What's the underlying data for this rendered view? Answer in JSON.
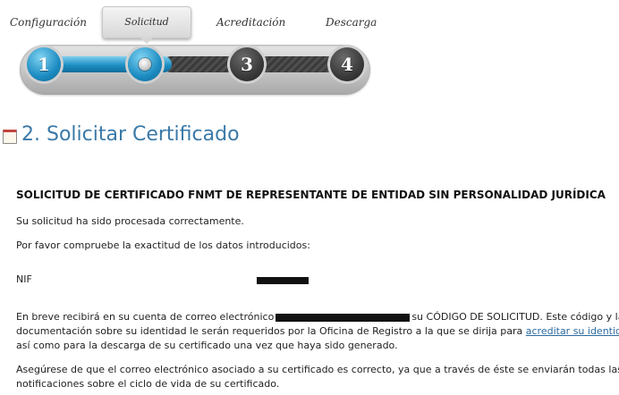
{
  "stepper": {
    "steps": [
      {
        "label": "Configuración",
        "number": "1"
      },
      {
        "label": "Solicitud",
        "number": ""
      },
      {
        "label": "Acreditación",
        "number": "3"
      },
      {
        "label": "Descarga",
        "number": "4"
      }
    ],
    "current_step": 2,
    "colors": {
      "done": "#1e8fc4",
      "pending": "#3a3a3a"
    }
  },
  "header": {
    "title": "2. Solicitar Certificado",
    "icon": "calendar-icon"
  },
  "content": {
    "heading": "SOLICITUD DE CERTIFICADO FNMT DE REPRESENTANTE DE ENTIDAD SIN PERSONALIDAD JURÍDICA",
    "processed_msg": "Su solicitud ha sido procesada correctamente.",
    "check_msg": "Por favor compruebe la exactitud de los datos introducidos:",
    "nif_label": "NIF",
    "email_p1": "En breve recibirá en su cuenta de correo electrónico",
    "email_p2": "su CÓDIGO DE SOLICITUD. Este código y la",
    "email_p3": "documentación sobre su identidad le serán requeridos por la Oficina de Registro a la que se dirija para",
    "email_link": "acreditar su identidad",
    "email_p4": "así como para la descarga de su certificado una vez que haya sido generado.",
    "notice_line1": "Asegúrese de que el correo electrónico asociado a su certificado es correcto, ya que a través de éste se enviarán todas las",
    "notice_line2": "notificaciones sobre el ciclo de vida de su certificado."
  }
}
